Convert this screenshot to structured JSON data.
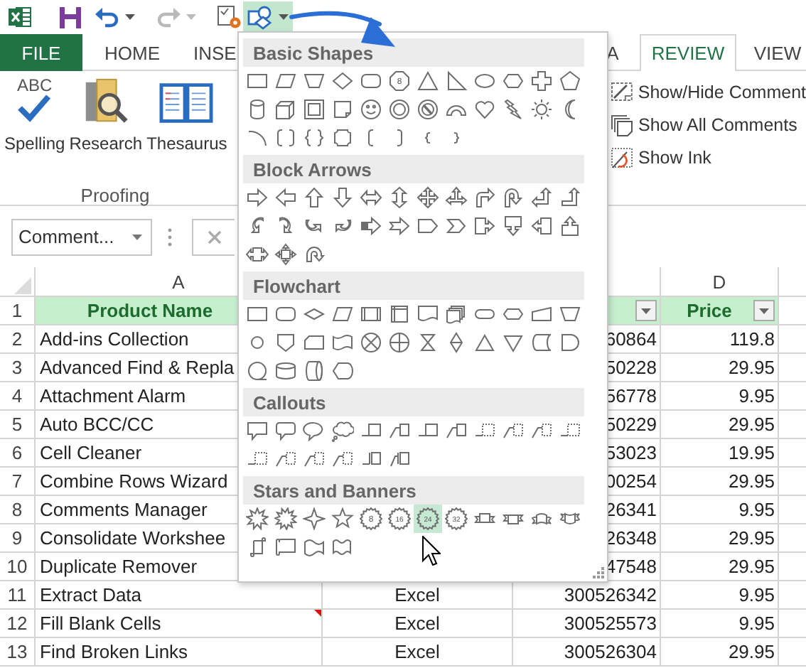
{
  "quick_access_toolbar": {
    "shapes_button": {
      "expanded": true
    }
  },
  "ribbon": {
    "tabs": [
      {
        "label": "FILE",
        "kind": "file",
        "selected": false
      },
      {
        "label": "HOME",
        "kind": "tab",
        "selected": false
      },
      {
        "label": "INSE",
        "kind": "tab",
        "selected": false
      },
      {
        "label": "A",
        "kind": "tab",
        "selected": false
      },
      {
        "label": "REVIEW",
        "kind": "tab",
        "selected": true
      },
      {
        "label": "VIEW",
        "kind": "tab",
        "selected": false
      }
    ],
    "proofing": {
      "buttons": [
        {
          "label": "Spelling",
          "kind": "spelling",
          "icon_text": "ABC"
        },
        {
          "label": "Research",
          "kind": "research"
        },
        {
          "label": "Thesaurus",
          "kind": "thesaurus"
        }
      ],
      "group_label": "Proofing"
    },
    "comments": [
      {
        "label": "Show/Hide Comment",
        "kind": "show-hide"
      },
      {
        "label": "Show All Comments",
        "kind": "show-all"
      },
      {
        "label": "Show Ink",
        "kind": "ink"
      }
    ]
  },
  "formula_bar": {
    "name_box": "Comment..."
  },
  "sheet": {
    "columns": {
      "a": {
        "letter": "A",
        "header": "Product Name"
      },
      "c": {
        "filter": true
      },
      "d": {
        "letter": "D",
        "header": "Price",
        "filter": true
      }
    },
    "header_row_number": "1",
    "rows": [
      {
        "number": "2",
        "product": "Add-ins Collection",
        "column_c": "60864",
        "price": "119.8",
        "comment": false
      },
      {
        "number": "3",
        "product": "Advanced Find & Repla",
        "column_c": "50228",
        "price": "29.95",
        "comment": false
      },
      {
        "number": "4",
        "product": "Attachment Alarm",
        "column_c": "56778",
        "price": "9.95",
        "comment": false
      },
      {
        "number": "5",
        "product": "Auto BCC/CC",
        "column_c": "50229",
        "price": "29.95",
        "comment": false
      },
      {
        "number": "6",
        "product": "Cell Cleaner",
        "column_c": "53023",
        "price": "19.95",
        "comment": false
      },
      {
        "number": "7",
        "product": "Combine Rows Wizard",
        "column_c": "00254",
        "price": "29.95",
        "comment": false
      },
      {
        "number": "8",
        "product": "Comments Manager",
        "column_c": "26341",
        "price": "9.95",
        "comment": false
      },
      {
        "number": "9",
        "product": "Consolidate Workshee",
        "column_c": "26348",
        "price": "29.95",
        "comment": false
      },
      {
        "number": "10",
        "product": "Duplicate Remover",
        "column_c": "47548",
        "price": "29.95",
        "comment": false
      },
      {
        "number": "11",
        "product": "Extract Data",
        "column_b": "Excel",
        "column_c": "300526342",
        "price": "9.95",
        "comment": false
      },
      {
        "number": "12",
        "product": "Fill Blank Cells",
        "column_b": "Excel",
        "column_c": "300525573",
        "price": "9.95",
        "comment": true
      },
      {
        "number": "13",
        "product": "Find Broken Links",
        "column_b": "Excel",
        "column_c": "300526304",
        "price": "29.95",
        "comment": false
      }
    ]
  },
  "shape_gallery": {
    "sections": [
      {
        "title": "Basic Shapes",
        "shapes": [
          {
            "kind": "rectangle",
            "selected": false
          },
          {
            "kind": "parallelogram",
            "selected": false
          },
          {
            "kind": "trapezoid",
            "selected": false
          },
          {
            "kind": "diamond",
            "selected": false
          },
          {
            "kind": "rounded-rectangle",
            "selected": false
          },
          {
            "kind": "octagon",
            "label": "8",
            "selected": false
          },
          {
            "kind": "triangle",
            "selected": false
          },
          {
            "kind": "right-triangle",
            "selected": false
          },
          {
            "kind": "oval",
            "selected": false
          },
          {
            "kind": "hexagon",
            "selected": false
          },
          {
            "kind": "cross",
            "selected": false
          },
          {
            "kind": "pentagon",
            "selected": false
          },
          {
            "kind": "can",
            "selected": false
          },
          {
            "kind": "cube",
            "selected": false
          },
          {
            "kind": "bevel",
            "selected": false
          },
          {
            "kind": "folded-corner",
            "selected": false
          },
          {
            "kind": "smiley",
            "selected": false
          },
          {
            "kind": "donut",
            "selected": false
          },
          {
            "kind": "no-symbol",
            "selected": false
          },
          {
            "kind": "block-arc",
            "selected": false
          },
          {
            "kind": "heart",
            "selected": false
          },
          {
            "kind": "lightning",
            "selected": false
          },
          {
            "kind": "sun",
            "selected": false
          },
          {
            "kind": "moon",
            "selected": false
          },
          {
            "kind": "arc",
            "selected": false
          },
          {
            "kind": "double-bracket",
            "selected": false
          },
          {
            "kind": "double-brace",
            "selected": false
          },
          {
            "kind": "plaque",
            "selected": false
          },
          {
            "kind": "left-bracket",
            "selected": false
          },
          {
            "kind": "right-bracket",
            "selected": false
          },
          {
            "kind": "left-brace",
            "selected": false
          },
          {
            "kind": "right-brace",
            "selected": false
          }
        ]
      },
      {
        "title": "Block Arrows",
        "shapes": [
          {
            "kind": "right-arrow",
            "selected": false
          },
          {
            "kind": "left-arrow",
            "selected": false
          },
          {
            "kind": "up-arrow",
            "selected": false
          },
          {
            "kind": "down-arrow",
            "selected": false
          },
          {
            "kind": "left-right-arrow",
            "selected": false
          },
          {
            "kind": "up-down-arrow",
            "selected": false
          },
          {
            "kind": "quad-arrow",
            "selected": false
          },
          {
            "kind": "left-right-up-arrow",
            "selected": false
          },
          {
            "kind": "bent-arrow",
            "selected": false
          },
          {
            "kind": "u-turn-arrow",
            "selected": false
          },
          {
            "kind": "left-up-arrow",
            "selected": false
          },
          {
            "kind": "bent-up-arrow",
            "selected": false
          },
          {
            "kind": "curved-right-arrow",
            "selected": false
          },
          {
            "kind": "curved-left-arrow",
            "selected": false
          },
          {
            "kind": "curved-down-arrow",
            "selected": false
          },
          {
            "kind": "curved-up-arrow",
            "selected": false
          },
          {
            "kind": "striped-right-arrow",
            "selected": false
          },
          {
            "kind": "notched-right-arrow",
            "selected": false
          },
          {
            "kind": "pentagon-arrow",
            "selected": false
          },
          {
            "kind": "chevron",
            "selected": false
          },
          {
            "kind": "right-arrow-callout",
            "selected": false
          },
          {
            "kind": "down-arrow-callout",
            "selected": false
          },
          {
            "kind": "left-arrow-callout",
            "selected": false
          },
          {
            "kind": "up-arrow-callout",
            "selected": false
          },
          {
            "kind": "left-right-arrow-callout",
            "selected": false
          },
          {
            "kind": "quad-arrow-callout",
            "selected": false
          },
          {
            "kind": "circular-arrow",
            "selected": false
          }
        ]
      },
      {
        "title": "Flowchart",
        "shapes": [
          {
            "kind": "process",
            "selected": false
          },
          {
            "kind": "alternate-process",
            "selected": false
          },
          {
            "kind": "decision",
            "selected": false
          },
          {
            "kind": "data",
            "selected": false
          },
          {
            "kind": "predefined-process",
            "selected": false
          },
          {
            "kind": "internal-storage",
            "selected": false
          },
          {
            "kind": "document",
            "selected": false
          },
          {
            "kind": "multidocument",
            "selected": false
          },
          {
            "kind": "terminator",
            "selected": false
          },
          {
            "kind": "preparation",
            "selected": false
          },
          {
            "kind": "manual-input",
            "selected": false
          },
          {
            "kind": "manual-operation",
            "selected": false
          },
          {
            "kind": "connector",
            "selected": false
          },
          {
            "kind": "off-page-connector",
            "selected": false
          },
          {
            "kind": "card",
            "selected": false
          },
          {
            "kind": "punched-tape",
            "selected": false
          },
          {
            "kind": "summing-junction",
            "selected": false
          },
          {
            "kind": "or",
            "selected": false
          },
          {
            "kind": "collate",
            "selected": false
          },
          {
            "kind": "sort",
            "selected": false
          },
          {
            "kind": "extract",
            "selected": false
          },
          {
            "kind": "merge",
            "selected": false
          },
          {
            "kind": "stored-data",
            "selected": false
          },
          {
            "kind": "delay",
            "selected": false
          },
          {
            "kind": "sequential-access",
            "selected": false
          },
          {
            "kind": "magnetic-disk",
            "selected": false
          },
          {
            "kind": "direct-access",
            "selected": false
          },
          {
            "kind": "display",
            "selected": false
          }
        ]
      },
      {
        "title": "Callouts",
        "shapes": [
          {
            "kind": "rect-callout",
            "selected": false
          },
          {
            "kind": "rounded-callout",
            "selected": false
          },
          {
            "kind": "oval-callout",
            "selected": false
          },
          {
            "kind": "cloud-callout",
            "selected": false
          },
          {
            "kind": "line-callout",
            "selected": false
          },
          {
            "kind": "bent-line-callout",
            "selected": false
          },
          {
            "kind": "line-callout",
            "selected": false
          },
          {
            "kind": "bent-line-callout",
            "selected": false
          },
          {
            "kind": "dashed-line-callout",
            "selected": false
          },
          {
            "kind": "dashed-bent-callout",
            "selected": false
          },
          {
            "kind": "dashed-bent-callout",
            "selected": false
          },
          {
            "kind": "dashed-line-callout",
            "selected": false
          },
          {
            "kind": "dashed-line-callout",
            "selected": false
          },
          {
            "kind": "dashed-bent-callout",
            "selected": false
          },
          {
            "kind": "dashed-bent-callout",
            "selected": false
          },
          {
            "kind": "dashed-bent-callout",
            "selected": false
          },
          {
            "kind": "accent-line-callout",
            "selected": false
          },
          {
            "kind": "accent-bent-callout",
            "selected": false
          }
        ]
      },
      {
        "title": "Stars and Banners",
        "shapes": [
          {
            "kind": "explosion",
            "selected": false
          },
          {
            "kind": "explosion-large",
            "selected": false
          },
          {
            "kind": "four-point-star",
            "selected": false
          },
          {
            "kind": "five-point-star",
            "selected": false
          },
          {
            "kind": "seal",
            "label": "8",
            "selected": false
          },
          {
            "kind": "seal",
            "label": "16",
            "selected": false
          },
          {
            "kind": "seal",
            "label": "24",
            "selected": true
          },
          {
            "kind": "seal",
            "label": "32",
            "selected": false
          },
          {
            "kind": "ribbon-down",
            "selected": false
          },
          {
            "kind": "ribbon-up",
            "selected": false
          },
          {
            "kind": "curved-ribbon-down",
            "selected": false
          },
          {
            "kind": "curved-ribbon-up",
            "selected": false
          },
          {
            "kind": "vertical-scroll",
            "selected": false
          },
          {
            "kind": "horizontal-scroll",
            "selected": false
          },
          {
            "kind": "wave",
            "selected": false
          },
          {
            "kind": "double-wave",
            "selected": false
          }
        ]
      }
    ]
  }
}
